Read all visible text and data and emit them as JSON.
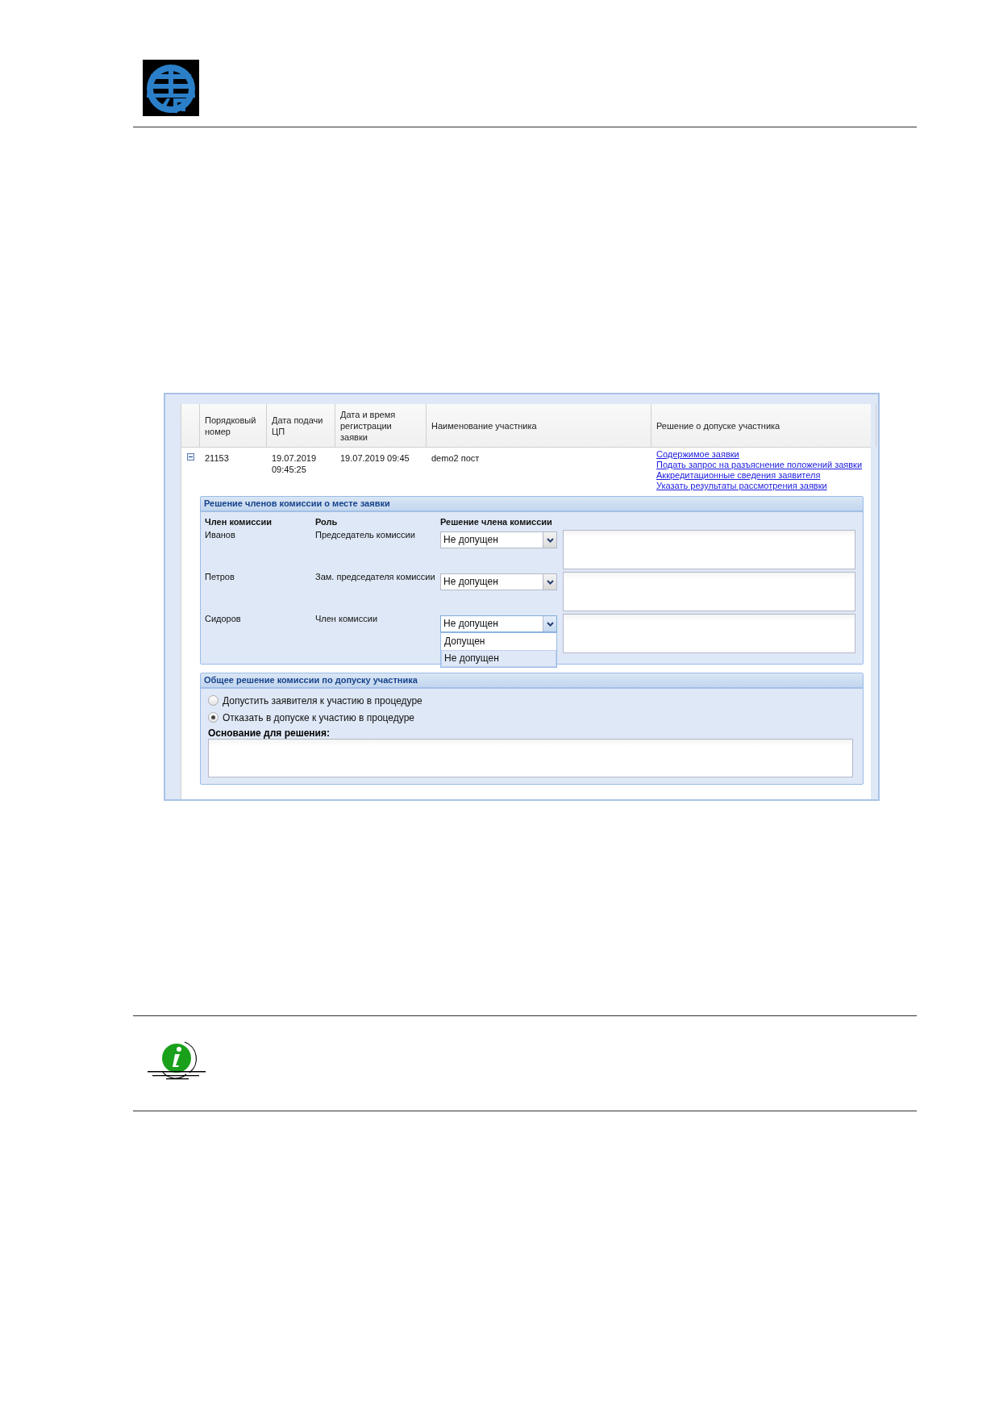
{
  "table": {
    "columns": [
      "Порядковый номер",
      "Дата подачи ЦП",
      "Дата и время регистрации заявки",
      "Наименование участника",
      "Решение о допуске участника"
    ],
    "rows": [
      {
        "expanded": true,
        "cells": [
          "21153",
          "19.07.2019 09:45:25",
          "19.07.2019 09:45",
          "demo2 пост"
        ],
        "links": [
          "Содержимое заявки",
          "Подать запрос на разъяснение положений заявки",
          "Аккредитационные сведения заявителя",
          "Указать результаты рассмотрения заявки"
        ]
      }
    ]
  },
  "members_panel": {
    "title": "Решение членов комиссии о месте заявки",
    "columns": [
      "Член комиссии",
      "Роль",
      "Решение члена комиссии"
    ],
    "members": [
      {
        "name": "Иванов",
        "role": "Председатель комиссии",
        "decision": "Не допущен",
        "dropdown_open": false
      },
      {
        "name": "Петров",
        "role": "Зам. председателя комиссии",
        "decision": "Не допущен",
        "dropdown_open": false
      },
      {
        "name": "Сидоров",
        "role": "Член комиссии",
        "decision": "Не допущен",
        "dropdown_open": true
      }
    ],
    "dropdown_options": [
      {
        "label": "Допущен",
        "selected": false
      },
      {
        "label": "Не допущен",
        "selected": true
      }
    ]
  },
  "overall_panel": {
    "title": "Общее решение комиссии по допуску участника",
    "options": [
      {
        "label": "Допустить заявителя к участию в процедуре",
        "selected": false
      },
      {
        "label": "Отказать в допуске к участию в процедуре",
        "selected": true
      }
    ],
    "basis_label": "Основание для решения:"
  }
}
